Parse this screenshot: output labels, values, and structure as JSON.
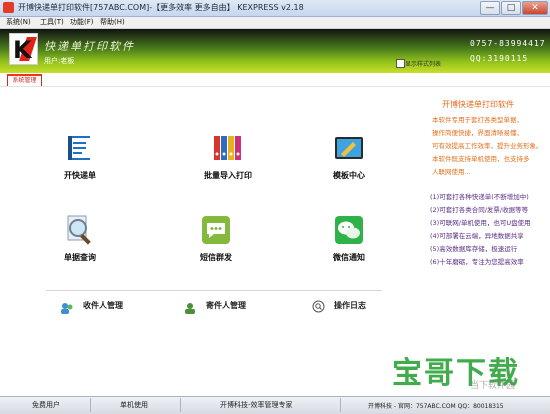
{
  "window": {
    "title": "开博快递单打印软件[757ABC.COM]-【更多效率 更多自由】 KEXPRESS v2.18",
    "min": "—",
    "max": "□",
    "close": "✕"
  },
  "menu": [
    "系统(N)",
    "工具(T)",
    "功能(F)",
    "帮助(H)"
  ],
  "banner": {
    "brand": "快递单打印软件",
    "user_label": "用户:老板",
    "phone": "0757-83994417",
    "qq": "QQ:3190115",
    "style_list": "显示样式列表"
  },
  "tab": "系统管理",
  "tiles": [
    {
      "label": "开快递单",
      "icon": "book-icon"
    },
    {
      "label": "批量导入打印",
      "icon": "binders-icon"
    },
    {
      "label": "模板中心",
      "icon": "template-icon"
    },
    {
      "label": "单据查询",
      "icon": "magnifier-icon"
    },
    {
      "label": "短信群发",
      "icon": "sms-icon"
    },
    {
      "label": "微信通知",
      "icon": "wechat-icon"
    }
  ],
  "links": [
    {
      "label": "收件人管理",
      "icon": "recipients-icon"
    },
    {
      "label": "寄件人管理",
      "icon": "sender-icon"
    },
    {
      "label": "操作日志",
      "icon": "log-icon"
    }
  ],
  "right_panel": {
    "title": "开博快递单打印软件",
    "intro": [
      "本软件专用于套打各类型单据，",
      "操作简便快捷，界面清晰易懂，",
      "可有效提高工作效率，提升业务形象。",
      "本软件既支持单机使用，也支持多",
      "人联网使用..."
    ],
    "features": [
      "(1)可套打各种快递单(不断增加中)",
      "(2)可套打各类合同/发票/收据等等",
      "(3)可联网/单机使用，也可U盘使用",
      "(4)可部署在云端，异地数据共享",
      "(5)高效数据库存储，极速运行",
      "(6)十年磨砺，专注为您提高效率"
    ]
  },
  "status": {
    "user": "免费用户",
    "mode": "单机使用",
    "company": "开博科技-效率管理专家",
    "footer": "开博科技 - 官网：757ABC.COM   QQ：80018315"
  },
  "watermark": {
    "main": "宝哥下载",
    "sub": "当下软件园"
  },
  "colors": {
    "accent_orange": "#e86a1a",
    "feature_purple": "#5a2d86",
    "tab_red": "#d22222",
    "watermark_green": "#2ea33a"
  }
}
